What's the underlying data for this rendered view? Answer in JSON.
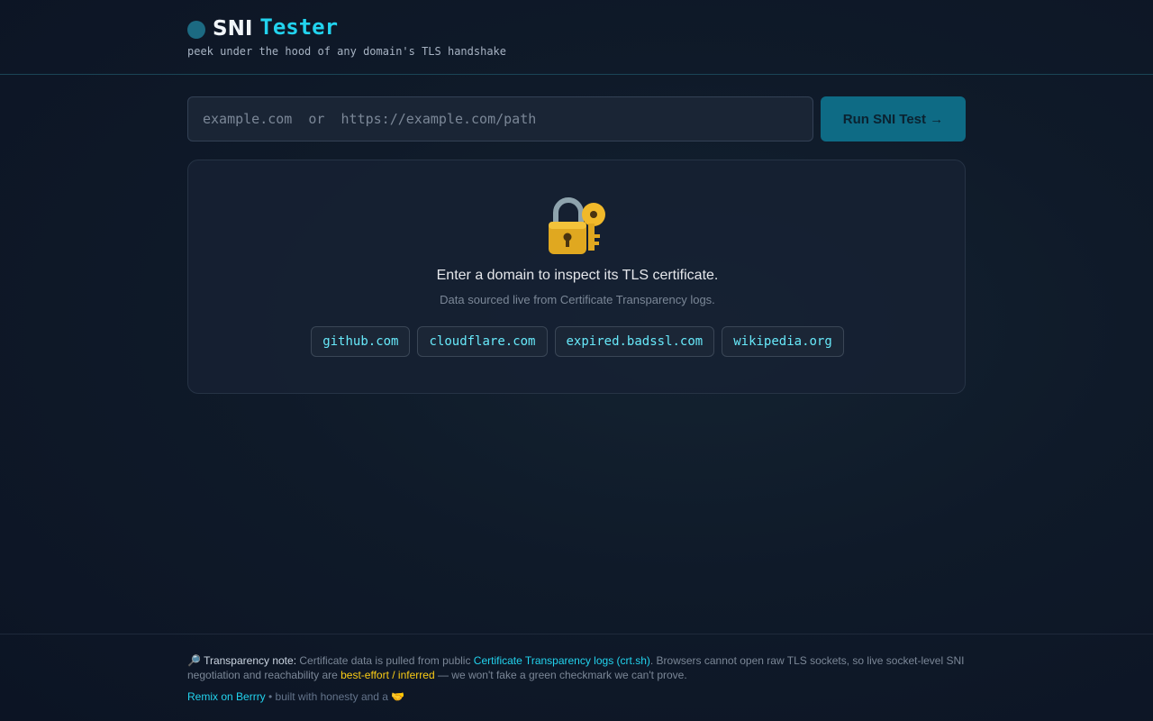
{
  "header": {
    "brand_primary": "SNI",
    "brand_secondary": "Tester",
    "tagline": "peek under the hood of any domain's TLS handshake"
  },
  "search": {
    "placeholder": "example.com  or  https://example.com/path",
    "value": "",
    "button_label": "Run SNI Test →"
  },
  "empty_state": {
    "icon": "lock-with-key-icon",
    "title": "Enter a domain to inspect its TLS certificate.",
    "subtitle": "Data sourced live from Certificate Transparency logs.",
    "examples": [
      "github.com",
      "cloudflare.com",
      "expired.badssl.com",
      "wikipedia.org"
    ]
  },
  "footer": {
    "note_icon": "🔎",
    "note_label": "Transparency note:",
    "note_part1": " Certificate data is pulled from public ",
    "note_link": "Certificate Transparency logs (crt.sh)",
    "note_part2": ". Browsers cannot open raw TLS sockets, so live socket-level SNI negotiation and reachability are ",
    "note_highlight": "best-effort / inferred",
    "note_part3": " — we won't fake a green checkmark we can't prove.",
    "credits_link": "Remix on Berrry",
    "credits_text": " • built with honesty and a 🤝"
  },
  "colors": {
    "accent": "#22d3ee",
    "button": "#0e6b85",
    "warning": "#facc15",
    "background": "#0f1a29"
  }
}
